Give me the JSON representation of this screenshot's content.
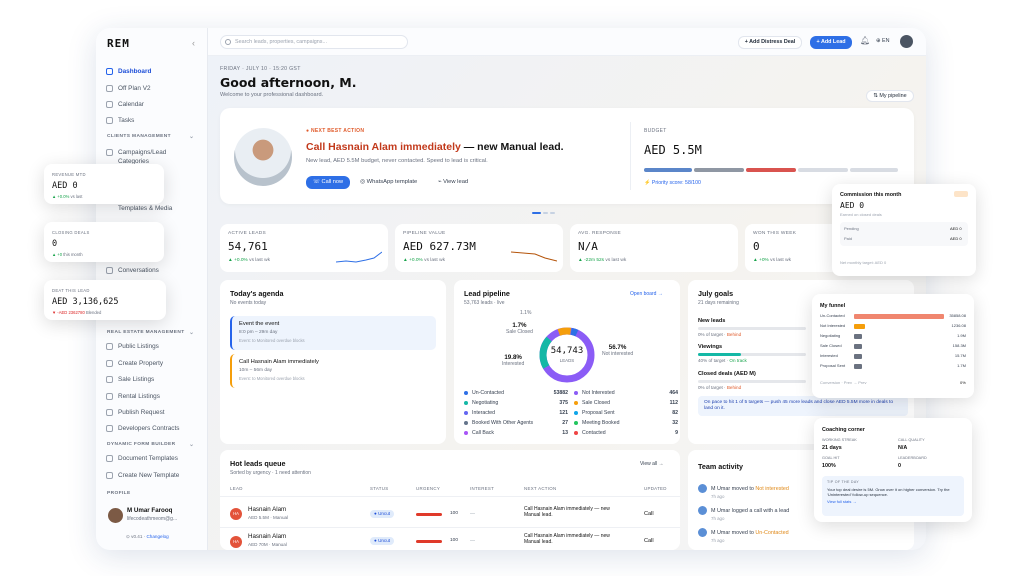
{
  "app": {
    "logo": "REM"
  },
  "sidebar": {
    "items": [
      {
        "label": "Dashboard"
      },
      {
        "label": "Off Plan V2"
      },
      {
        "label": "Calendar"
      },
      {
        "label": "Tasks"
      },
      {
        "label": "Campaigns/Lead"
      },
      {
        "label": "Categories"
      },
      {
        "label": "Templates & Media"
      },
      {
        "label": "Conversations"
      },
      {
        "label": "Public Listings"
      },
      {
        "label": "Create Property"
      },
      {
        "label": "Sale Listings"
      },
      {
        "label": "Rental Listings"
      },
      {
        "label": "Publish Request"
      },
      {
        "label": "Developers Contracts"
      },
      {
        "label": "Document Templates"
      },
      {
        "label": "Create New Template"
      }
    ],
    "sections": {
      "clients": "CLIENTS MANAGEMENT",
      "real_estate": "REAL ESTATE MANAGEMENT",
      "forms": "DYNAMIC FORM BUILDER",
      "profile": "PROFILE"
    },
    "profile": {
      "name": "M Umar Farooq",
      "email": "lifecodeathmeom@g..."
    },
    "version": "v0.41",
    "version_link": "Changelog"
  },
  "topbar": {
    "search_placeholder": "Search leads, properties, campaigns...",
    "distress_label": "Add Distress Deal",
    "add_lead_label": "Add Lead",
    "lang": "EN"
  },
  "header": {
    "date": "FRIDAY · JULY 10 · 15:20 GST",
    "greeting": "Good afternoon, M.",
    "welcome": "Welcome to your professional dashboard.",
    "my_pipeline": "My pipeline"
  },
  "nba": {
    "tag": "NEXT BEST ACTION",
    "title_main": "Call Hasnain Alam immediately",
    "title_rest": " — new Manual lead.",
    "desc": "New lead, AED 5.5M budget, never contacted. Speed to lead is critical.",
    "call_now": "Call now",
    "whatsapp": "WhatsApp template",
    "view_lead": "View lead",
    "budget_label": "BUDGET",
    "budget_value": "AED 5.5M",
    "priority": "Priority score: 58/100"
  },
  "kpis": [
    {
      "label": "ACTIVE LEADS",
      "value": "54,761",
      "delta": "▲ +0.0%",
      "note": "vs last wk"
    },
    {
      "label": "PIPELINE VALUE",
      "value": "AED 627.73M",
      "delta": "▲ +0.0%",
      "note": "vs last wk"
    },
    {
      "label": "AVG. RESPONSE",
      "value": "N/A",
      "delta": "▲ -22m 52s",
      "note": "vs last wk"
    },
    {
      "label": "WON THIS WEEK",
      "value": "0",
      "delta": "▲ +0%",
      "note": "vs last wk"
    }
  ],
  "agenda": {
    "title": "Today's agenda",
    "sub": "No events today",
    "items": [
      {
        "title": "Event the event",
        "time": "8:0 pm – 29m day",
        "note": "Event: to Monitored overdue blocks"
      },
      {
        "title": "Call Hasnain Alam immediately",
        "time": "10m – 56m day",
        "note": "Event: to Monitored overdue blocks"
      }
    ]
  },
  "pipeline": {
    "title": "Lead pipeline",
    "sub": "53,763 leads · live",
    "open": "Open board →",
    "center_value": "54,743",
    "center_label": "LEADS",
    "labels": [
      {
        "pct": "1.1%",
        "name": ""
      },
      {
        "pct": "1.7%",
        "name": "Sale Closed"
      },
      {
        "pct": "19.8%",
        "name": "Interested"
      },
      {
        "pct": "56.7%",
        "name": "Not interested"
      }
    ],
    "legend": [
      {
        "name": "Un-Contacted",
        "value": "53882",
        "color": "#2e6fe6"
      },
      {
        "name": "Not Interested",
        "value": "464",
        "color": "#8b5cf6"
      },
      {
        "name": "Negotiating",
        "value": "375",
        "color": "#14b8a6"
      },
      {
        "name": "Sale Closed",
        "value": "112",
        "color": "#f59e0b"
      },
      {
        "name": "Interacted",
        "value": "121",
        "color": "#6366f1"
      },
      {
        "name": "Proposal Sent",
        "value": "82",
        "color": "#0ea5e9"
      },
      {
        "name": "Booked With Other Agents",
        "value": "27",
        "color": "#64748b"
      },
      {
        "name": "Meeting Booked",
        "value": "32",
        "color": "#22c55e"
      },
      {
        "name": "Call Back",
        "value": "13",
        "color": "#a855f7"
      },
      {
        "name": "Contacted",
        "value": "9",
        "color": "#ef4444"
      }
    ]
  },
  "goals": {
    "title": "July goals",
    "sub": "21 days remaining",
    "items": [
      {
        "label": "New leads",
        "status": "0% of target ·",
        "flag": "Behind",
        "pct": 0,
        "color": "#2e6fe6"
      },
      {
        "label": "Viewings",
        "status": "40% of target ·",
        "flag": "On track",
        "pct": 40,
        "color": "#14b8a6"
      },
      {
        "label": "Closed deals (AED M)",
        "status": "0% of target ·",
        "flag": "Behind",
        "pct": 0,
        "color": "#f59e0b"
      }
    ],
    "note": "On pace to hit 1 of 5 targets — push 45 more leads and close AED 5.5M more in deals to land on it."
  },
  "hot": {
    "title": "Hot leads queue",
    "sub": "Sorted by urgency · 1 need attention",
    "view_all": "View all →",
    "headers": [
      "LEAD",
      "STATUS",
      "URGENCY",
      "INTEREST",
      "NEXT ACTION",
      "UPDATED"
    ],
    "rows": [
      {
        "initials": "HA",
        "name": "Hasnain Alam",
        "sub": "AED 5.5M · Manual",
        "status": "Uncut",
        "urgency": "100",
        "interest": "—",
        "next": "Call Hasnain Alam immediately — new Manual lead.",
        "action": "Call"
      },
      {
        "initials": "HA",
        "name": "Hasnain Alam",
        "sub": "AED 70M · Manual",
        "status": "Uncut",
        "urgency": "100",
        "interest": "—",
        "next": "Call Hasnain Alam immediately — new Manual lead.",
        "action": "Call"
      }
    ]
  },
  "team": {
    "title": "Team activity",
    "items": [
      {
        "who": "M Umar",
        "text": " moved to ",
        "target": "Not interested",
        "ago": "7h ago"
      },
      {
        "who": "M Umar",
        "text": " logged a call with a lead",
        "target": "",
        "ago": "7h ago"
      },
      {
        "who": "M Umar",
        "text": " moved to ",
        "target": "Un-Contacted",
        "ago": "7h ago"
      }
    ]
  },
  "floats": {
    "revenue": {
      "label": "REVENUE MTD",
      "value": "AED 0",
      "delta": "▲ +0.0%",
      "note": "vs last"
    },
    "closing": {
      "label": "CLOSING DEALS",
      "value": "0",
      "delta": "▲ +0",
      "note": "this month"
    },
    "deals": {
      "label": "DEAT THIS LEAD",
      "value": "AED 3,136,625",
      "delta": "▼ -AED 2362780",
      "note": "Blended"
    },
    "commission": {
      "title": "Commission this month",
      "value": "AED 0",
      "sub": "Earned on closed deals",
      "rows": [
        {
          "label": "Pending",
          "value": "AED 0"
        },
        {
          "label": "Paid",
          "value": "AED 0"
        }
      ],
      "foot": "Net monthly target: AED 0"
    },
    "funnel": {
      "title": "My funnel",
      "rows": [
        {
          "label": "Un-Contacted",
          "value": "35858.08",
          "pct": 100,
          "color": "#f0866f"
        },
        {
          "label": "Not Interested",
          "value": "1236.08",
          "pct": 12,
          "color": "#f59e0b"
        },
        {
          "label": "Negotiating",
          "value": "1.9M",
          "pct": 8,
          "color": "#6b7280"
        },
        {
          "label": "Sale Closed",
          "value": "158.3M",
          "pct": 8,
          "color": "#6b7280"
        },
        {
          "label": "Interested",
          "value": "15.7M",
          "pct": 8,
          "color": "#6b7280"
        },
        {
          "label": "Proposal Sent",
          "value": "1.7M",
          "pct": 8,
          "color": "#6b7280"
        }
      ],
      "foot": "Conversion · Prev → Prev",
      "foot_value": "0%"
    },
    "coaching": {
      "title": "Coaching corner",
      "stats": [
        {
          "label": "WORKING STREAK",
          "value": "21 days"
        },
        {
          "label": "CALL QUALITY",
          "value": "N/A"
        },
        {
          "label": "GOAL HIT",
          "value": "100%"
        },
        {
          "label": "LEADERBOARD",
          "value": "0"
        }
      ],
      "tip_label": "TIP OF THE DAY",
      "tip": "Your top deal desire is 5M. Grow over it on higher conversion. Try the ‘Uninterested’ follow-up sequence.",
      "tip_link": "View full stats →"
    }
  }
}
